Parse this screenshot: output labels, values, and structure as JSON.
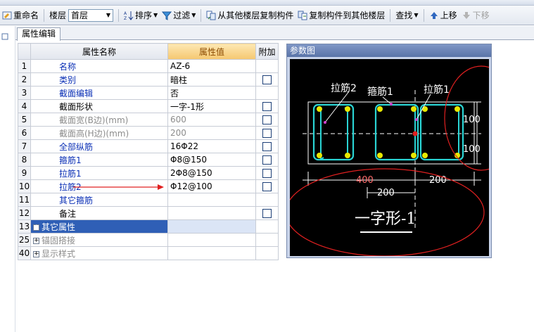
{
  "toolbar": {
    "rename": "重命名",
    "floor_label": "楼层",
    "floor_value": "首层",
    "sort": "排序",
    "filter": "过滤",
    "copy_from": "从其他楼层复制构件",
    "copy_to": "复制构件到其他楼层",
    "find": "查找",
    "move_up": "上移",
    "move_down": "下移"
  },
  "tab": {
    "label": "属性编辑"
  },
  "grid": {
    "headers": {
      "name": "属性名称",
      "value": "属性值",
      "extra": "附加"
    },
    "rows": [
      {
        "num": "1",
        "name": "名称",
        "value": "AZ-6",
        "style": "link",
        "check": false
      },
      {
        "num": "2",
        "name": "类别",
        "value": "暗柱",
        "style": "link",
        "check": true
      },
      {
        "num": "3",
        "name": "截面编辑",
        "value": "否",
        "style": "link",
        "check": false
      },
      {
        "num": "4",
        "name": "截面形状",
        "value": "一字-1形",
        "style": "normal",
        "check": true
      },
      {
        "num": "5",
        "name": "截面宽(B边)(mm)",
        "value": "600",
        "style": "grey",
        "check": true
      },
      {
        "num": "6",
        "name": "截面高(H边)(mm)",
        "value": "200",
        "style": "grey",
        "check": true
      },
      {
        "num": "7",
        "name": "全部纵筋",
        "value": "16Φ22",
        "style": "link",
        "check": true
      },
      {
        "num": "8",
        "name": "箍筋1",
        "value": "Φ8@150",
        "style": "link",
        "check": true
      },
      {
        "num": "9",
        "name": "拉筋1",
        "value": "2Φ8@150",
        "style": "link",
        "check": true
      },
      {
        "num": "10",
        "name": "拉筋2",
        "value": "Φ12@100",
        "style": "link",
        "check": true
      },
      {
        "num": "11",
        "name": "其它箍筋",
        "value": "",
        "style": "link",
        "check": false
      },
      {
        "num": "12",
        "name": "备注",
        "value": "",
        "style": "normal",
        "check": true
      },
      {
        "num": "13",
        "name": "其它属性",
        "value": "",
        "style": "group-selected",
        "check": false
      },
      {
        "num": "25",
        "name": "锚固搭接",
        "value": "",
        "style": "group",
        "check": false
      },
      {
        "num": "40",
        "name": "显示样式",
        "value": "",
        "style": "group",
        "check": false
      }
    ]
  },
  "param_figure": {
    "title": "参数图",
    "labels": {
      "tie2": "拉筋2",
      "stirrup1": "箍筋1",
      "tie1": "拉筋1",
      "dim_400": "400",
      "dim_200_inner": "200",
      "dim_200_right": "200",
      "dim_100_top": "100",
      "dim_100_bottom": "100",
      "shape_name": "一字形-1"
    },
    "colors": {
      "background": "#000000",
      "stirrup": "#2ad4d4",
      "rebar": "#e8e800",
      "dimension": "#ffffff",
      "annotation": "#e02020",
      "arrow": "#e02020"
    }
  }
}
